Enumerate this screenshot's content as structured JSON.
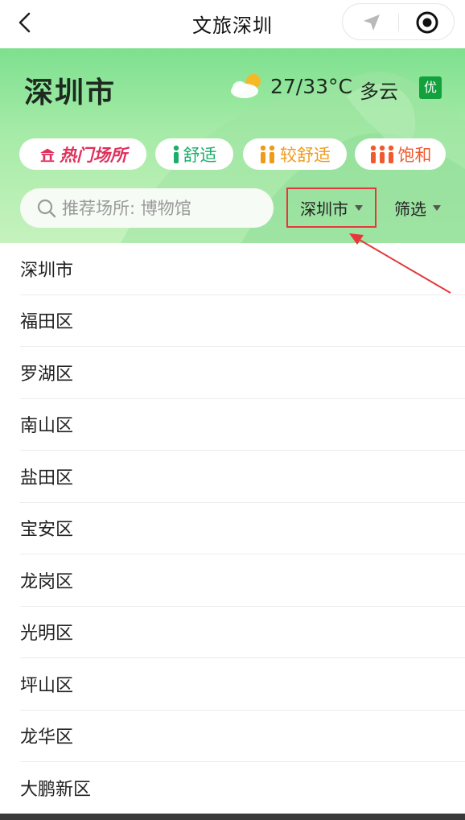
{
  "header": {
    "title": "文旅深圳"
  },
  "hero": {
    "city": "深圳市",
    "weather": {
      "temp": "27/33°C",
      "condition": "多云",
      "aqi": "优"
    },
    "chips": [
      {
        "label": "热门场所",
        "icon": "hot-place-icon",
        "color": "#e0305c"
      },
      {
        "label": "舒适",
        "icon": "single-person-icon",
        "color": "#1cad6a"
      },
      {
        "label": "较舒适",
        "icon": "two-person-icon",
        "color": "#f09a1a"
      },
      {
        "label": "饱和",
        "icon": "three-person-icon",
        "color": "#ef5a2e"
      }
    ],
    "search": {
      "placeholder": "推荐场所: 博物馆"
    },
    "city_select": "深圳市",
    "filter": "筛选"
  },
  "districts": [
    "深圳市",
    "福田区",
    "罗湖区",
    "南山区",
    "盐田区",
    "宝安区",
    "龙岗区",
    "光明区",
    "坪山区",
    "龙华区",
    "大鹏新区"
  ],
  "colors": {
    "accent_green": "#12a13c",
    "annotation_red": "#e5383b"
  }
}
